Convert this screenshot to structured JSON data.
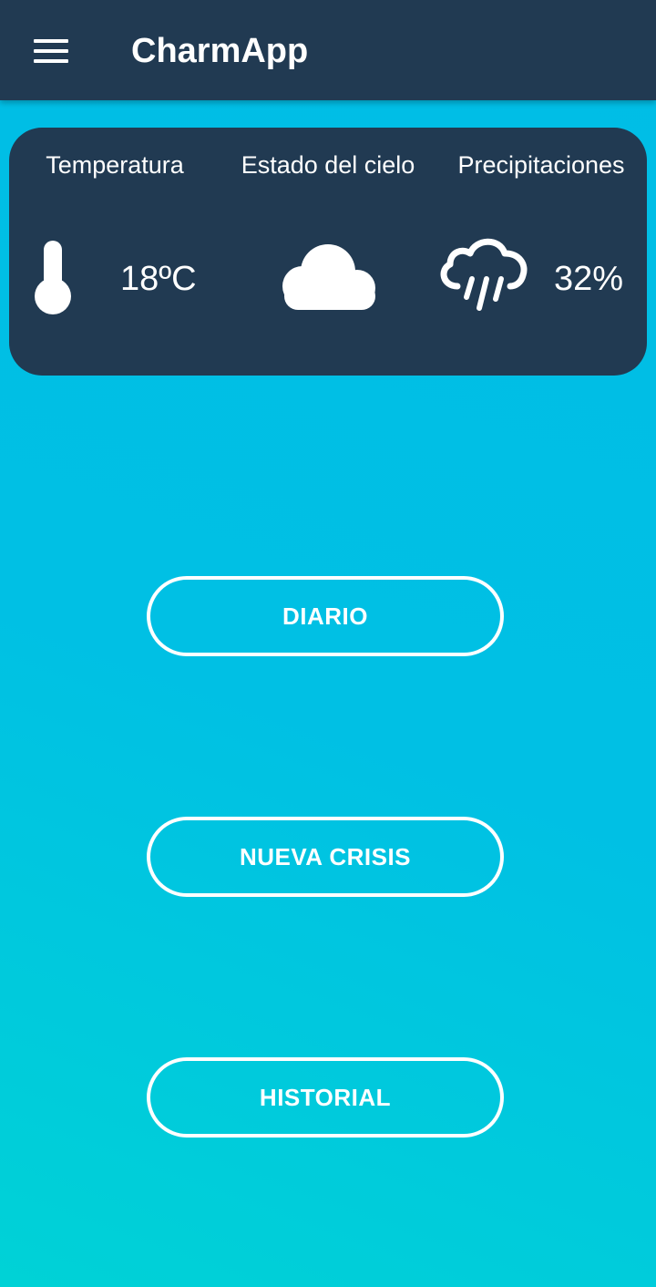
{
  "app": {
    "title": "CharmApp",
    "menu_icon": "hamburger-menu-icon"
  },
  "weather": {
    "temperature": {
      "label": "Temperatura",
      "value": "18ºC",
      "icon": "thermometer-icon"
    },
    "sky": {
      "label": "Estado del cielo",
      "icon": "cloud-icon"
    },
    "precipitation": {
      "label": "Precipitaciones",
      "value": "32%",
      "icon": "rain-cloud-icon"
    }
  },
  "actions": [
    {
      "label": "DIARIO"
    },
    {
      "label": "NUEVA CRISIS"
    },
    {
      "label": "HISTORIAL"
    }
  ],
  "colors": {
    "appbar": "#213a52",
    "card": "#213a52",
    "background_top": "#00bde6",
    "background_bottom": "#00d2d6",
    "foreground": "#ffffff"
  }
}
